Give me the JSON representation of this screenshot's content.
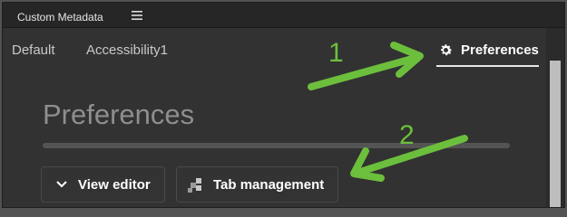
{
  "window": {
    "title": "Custom Metadata"
  },
  "tabs": [
    {
      "label": "Default"
    },
    {
      "label": "Accessibility1"
    },
    {
      "label": "Preferences"
    }
  ],
  "main": {
    "heading": "Preferences"
  },
  "buttons": {
    "view_editor": "View editor",
    "tab_management": "Tab management"
  },
  "annotations": {
    "step1": "1",
    "step2": "2"
  },
  "icons": {
    "menu": "hamburger-menu-icon",
    "gear": "gear-icon",
    "chevron": "chevron-down-icon",
    "tab_mgmt": "tab-management-icon"
  },
  "colors": {
    "annotation": "#6cbf3d",
    "panel": "#323232",
    "active_tab": "#ffffff"
  }
}
